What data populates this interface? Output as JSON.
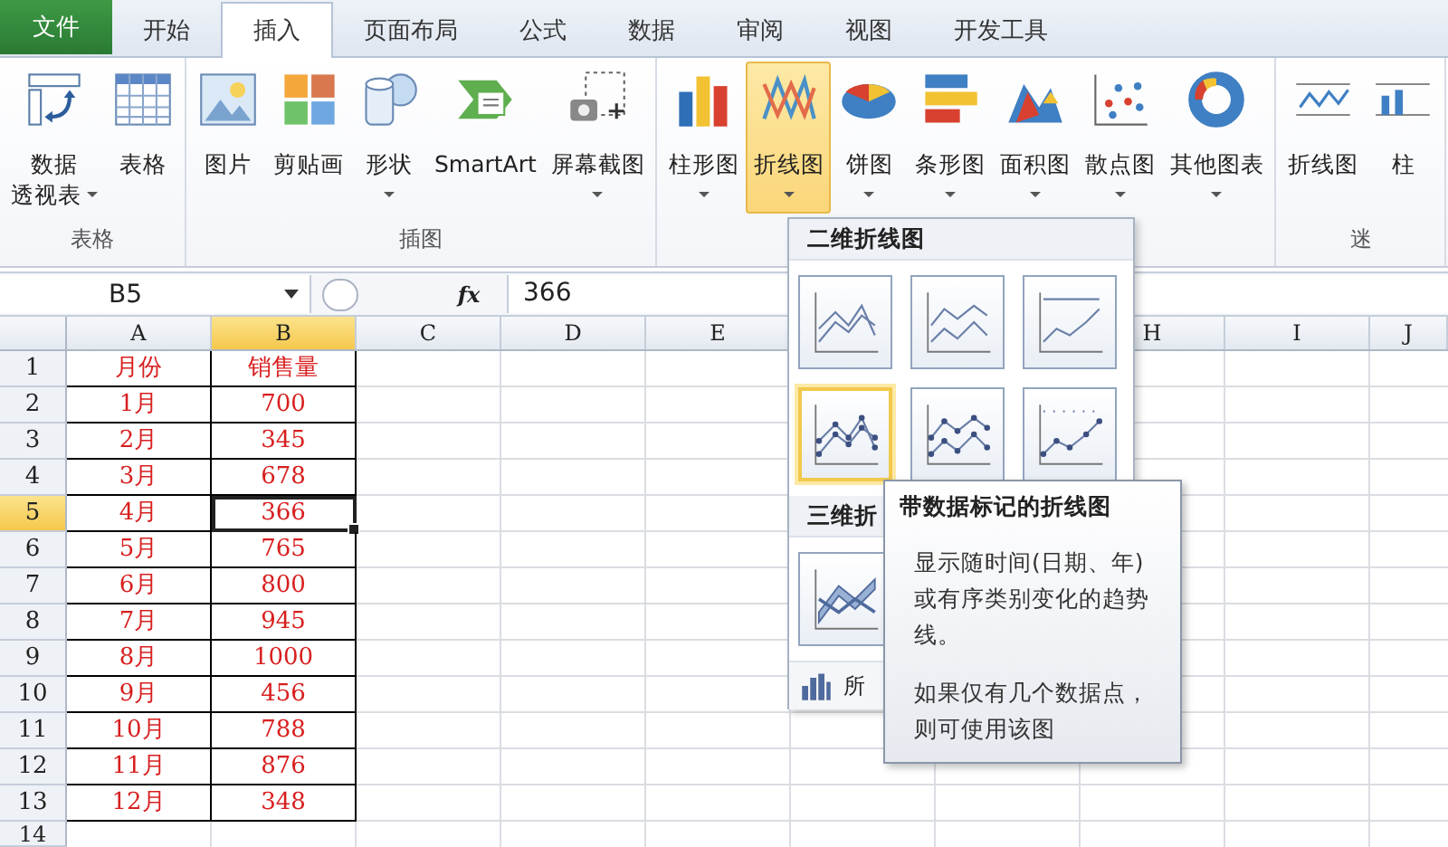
{
  "file_tab": "文件",
  "tabs": [
    {
      "label": "开始",
      "selected": false
    },
    {
      "label": "插入",
      "selected": true
    },
    {
      "label": "页面布局",
      "selected": false
    },
    {
      "label": "公式",
      "selected": false
    },
    {
      "label": "数据",
      "selected": false
    },
    {
      "label": "审阅",
      "selected": false
    },
    {
      "label": "视图",
      "selected": false
    },
    {
      "label": "开发工具",
      "selected": false
    }
  ],
  "ribbon": {
    "groups": [
      {
        "label": "表格",
        "buttons": [
          {
            "kind": "pivot",
            "label": "数据",
            "label2": "透视表",
            "dropdown": true,
            "selected": false
          },
          {
            "kind": "table",
            "label": "表格",
            "dropdown": false,
            "selected": false
          }
        ]
      },
      {
        "label": "插图",
        "buttons": [
          {
            "kind": "picture",
            "label": "图片",
            "dropdown": false,
            "selected": false
          },
          {
            "kind": "clipart",
            "label": "剪贴画",
            "dropdown": false,
            "selected": false
          },
          {
            "kind": "shapes",
            "label": "形状",
            "dropdown": true,
            "selected": false
          },
          {
            "kind": "smartart",
            "label": "SmartArt",
            "dropdown": false,
            "selected": false
          },
          {
            "kind": "screenshot",
            "label": "屏幕截图",
            "dropdown": true,
            "selected": false
          }
        ]
      },
      {
        "buttons": [
          {
            "kind": "column",
            "label": "柱形图",
            "dropdown": true,
            "selected": false
          },
          {
            "kind": "line",
            "label": "折线图",
            "dropdown": true,
            "selected": true
          },
          {
            "kind": "pie",
            "label": "饼图",
            "dropdown": true,
            "selected": false
          },
          {
            "kind": "bar",
            "label": "条形图",
            "dropdown": true,
            "selected": false
          },
          {
            "kind": "area",
            "label": "面积图",
            "dropdown": true,
            "selected": false
          },
          {
            "kind": "scatter",
            "label": "散点图",
            "dropdown": true,
            "selected": false
          },
          {
            "kind": "other",
            "label": "其他图表",
            "dropdown": true,
            "selected": false
          }
        ]
      },
      {
        "label": "迷",
        "buttons": [
          {
            "kind": "sparkline",
            "label": "折线图",
            "dropdown": false,
            "selected": false
          },
          {
            "kind": "sparkcolumn",
            "label": "柱",
            "dropdown": false,
            "selected": false
          }
        ]
      }
    ]
  },
  "formula_bar": {
    "name_box": "B5",
    "function_label": "fx",
    "value": "366"
  },
  "sheet": {
    "columns_left": [
      {
        "label": "A",
        "selected": false
      },
      {
        "label": "B",
        "selected": true
      },
      {
        "label": "C",
        "selected": false
      },
      {
        "label": "D",
        "selected": false
      },
      {
        "label": "E",
        "selected": false
      }
    ],
    "columns_right": [
      {
        "label": "H",
        "selected": false
      },
      {
        "label": "I",
        "selected": false
      },
      {
        "label": "J",
        "selected": false
      }
    ],
    "rows": [
      {
        "number": "1",
        "selected": false,
        "cells": [
          "月份",
          "销售量"
        ]
      },
      {
        "number": "2",
        "selected": false,
        "cells": [
          "1月",
          "700"
        ]
      },
      {
        "number": "3",
        "selected": false,
        "cells": [
          "2月",
          "345"
        ]
      },
      {
        "number": "4",
        "selected": false,
        "cells": [
          "3月",
          "678"
        ]
      },
      {
        "number": "5",
        "selected": true,
        "cells": [
          "4月",
          "366"
        ]
      },
      {
        "number": "6",
        "selected": false,
        "cells": [
          "5月",
          "765"
        ]
      },
      {
        "number": "7",
        "selected": false,
        "cells": [
          "6月",
          "800"
        ]
      },
      {
        "number": "8",
        "selected": false,
        "cells": [
          "7月",
          "945"
        ]
      },
      {
        "number": "9",
        "selected": false,
        "cells": [
          "8月",
          "1000"
        ]
      },
      {
        "number": "10",
        "selected": false,
        "cells": [
          "9月",
          "456"
        ]
      },
      {
        "number": "11",
        "selected": false,
        "cells": [
          "10月",
          "788"
        ]
      },
      {
        "number": "12",
        "selected": false,
        "cells": [
          "11月",
          "876"
        ]
      },
      {
        "number": "13",
        "selected": false,
        "cells": [
          "12月",
          "348"
        ]
      },
      {
        "number": "14",
        "selected": false,
        "cells": []
      }
    ]
  },
  "gallery": {
    "sections": [
      {
        "title": "二维折线图",
        "items": [
          {
            "kind": "line",
            "selected": false
          },
          {
            "kind": "stacked",
            "selected": false
          },
          {
            "kind": "percent",
            "selected": false
          },
          {
            "kind": "markers",
            "selected": true
          },
          {
            "kind": "stackedmarkers",
            "selected": false
          },
          {
            "kind": "percentmarkers",
            "selected": false
          }
        ]
      },
      {
        "title": "三维折",
        "items": [
          {
            "kind": "threed",
            "selected": false
          }
        ]
      }
    ],
    "footer": "所"
  },
  "tooltip": {
    "title": "带数据标记的折线图",
    "paragraphs": [
      "显示随时间(日期、年)或有序类别变化的趋势线。",
      "如果仅有几个数据点，则可使用该图"
    ]
  }
}
